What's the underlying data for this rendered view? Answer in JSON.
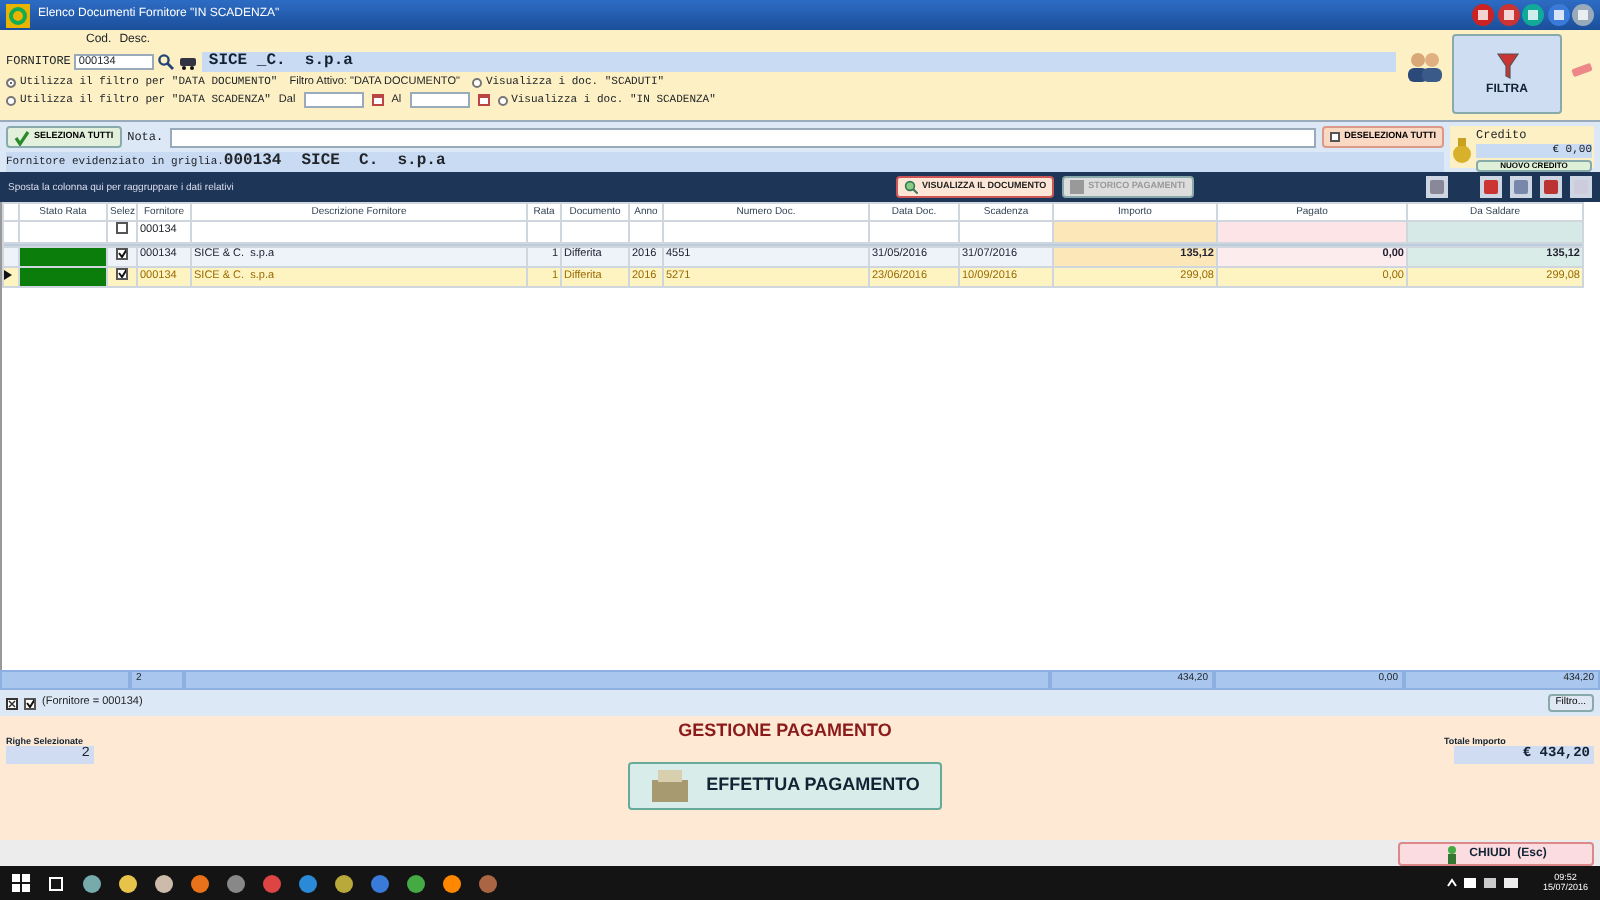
{
  "window": {
    "title": "Elenco Documenti Fornitore \"IN SCADENZA\""
  },
  "filter": {
    "cod_label": "Cod.",
    "desc_label": "Desc.",
    "supplier_label": "FORNITORE",
    "code": "000134",
    "supplier_name": "SICE _C.  s.p.a",
    "date_filters": [
      {
        "label": "Utilizza il filtro per \"DATA DOCUMENTO\"",
        "selected": true
      },
      {
        "label": "Utilizza il filtro per \"DATA SCADENZA\"",
        "selected": false
      }
    ],
    "active_filter": "Filtro Attivo: \"DATA DOCUMENTO\"",
    "from_label": "Dal",
    "to_label": "Al",
    "views": [
      {
        "label": "Visualizza i doc. \"SCADUTI\"",
        "selected": false
      },
      {
        "label": "Visualizza i doc. \"IN SCADENZA\"",
        "selected": false
      }
    ],
    "filter_button": "FILTRA"
  },
  "selection": {
    "select_all": "SELEZIONA TUTTI",
    "note_label": "Nota.",
    "deselect_all": "DESELEZIONA TUTTI",
    "highlight_label": "Fornitore evidenziato in griglia.",
    "highlight_code": "000134",
    "highlight_name": "SICE  C.  s.p.a",
    "credit": {
      "label": "Credito",
      "value": "€ 0,00",
      "button": "NUOVO CREDITO"
    }
  },
  "toolbar": {
    "group_hint": "Sposta la colonna qui per raggruppare i dati relativi",
    "buttons": [
      {
        "label": "VISUALIZZA IL DOCUMENTO",
        "disabled": false
      },
      {
        "label": "STORICO PAGAMENTI",
        "disabled": true
      }
    ]
  },
  "table": {
    "columns": [
      "Stato Rata",
      "Selez",
      "Fornitore",
      "Descrizione Fornitore",
      "Rata",
      "Documento",
      "Anno",
      "Numero Doc.",
      "Data Doc.",
      "Scadenza",
      "Importo",
      "Pagato",
      "Da Saldare"
    ],
    "filter_row": {
      "checked": false,
      "fornitore": "000134"
    },
    "rows": [
      {
        "color": "#0b7d0b",
        "checked": true,
        "selected": false,
        "bold_amounts": true,
        "cells": [
          "",
          "",
          "000134",
          "SICE & C.  s.p.a",
          "1",
          "Differita",
          "2016",
          "4551",
          "31/05/2016",
          "31/07/2016",
          "135,12",
          "0,00",
          "135,12"
        ]
      },
      {
        "color": "#0b7d0b",
        "checked": true,
        "selected": true,
        "bold_amounts": false,
        "cells": [
          "",
          "",
          "000134",
          "SICE & C.  s.p.a",
          "1",
          "Differita",
          "2016",
          "5271",
          "23/06/2016",
          "10/09/2016",
          "299,08",
          "0,00",
          "299,08"
        ]
      }
    ],
    "summary": {
      "count": "2",
      "importo": "434,20",
      "pagato": "0,00",
      "saldare": "434,20"
    }
  },
  "filter_bar": {
    "checked": true,
    "text": "(Fornitore = 000134)",
    "button": "Filtro..."
  },
  "payment": {
    "title": "GESTIONE PAGAMENTO",
    "rows_label": "Righe Selezionate",
    "rows_value": "2",
    "total_label": "Totale Importo",
    "total_value": "€ 434,20",
    "pay_button": "EFFETTUA PAGAMENTO"
  },
  "close_button": "CHIUDI  (Esc)",
  "taskbar": {
    "time": "09:52",
    "date": "15/07/2016"
  }
}
